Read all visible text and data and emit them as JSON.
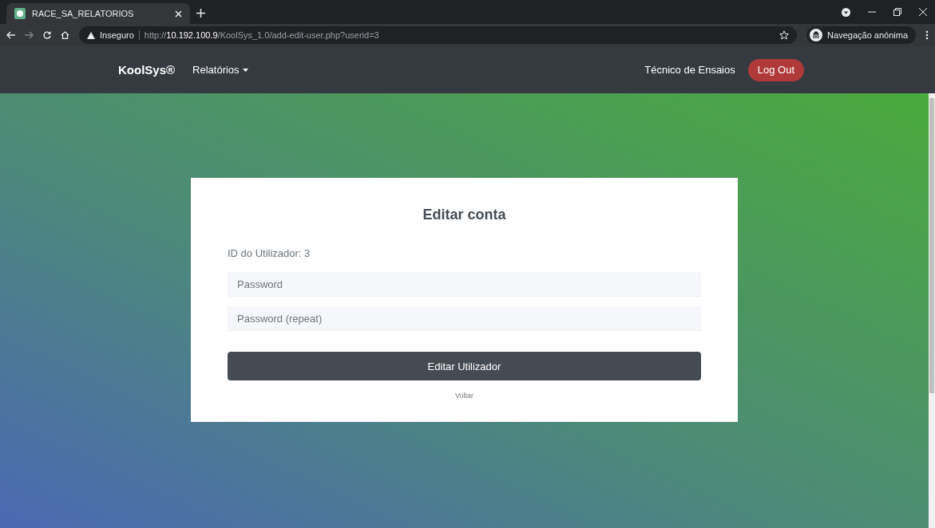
{
  "browser": {
    "tab_title": "RACE_SA_RELATORIOS",
    "security_label": "Inseguro",
    "url": "http://**10.192.100.9**/KoolSys_1.0/add-edit-user.php?userid=3",
    "profile_label": "Navegação anónima"
  },
  "navbar": {
    "brand": "KoolSys®",
    "menu": "Relatórios",
    "user": "Técnico de Ensaios",
    "logout": "Log Out"
  },
  "card": {
    "title": "Editar conta",
    "user_id": "ID do Utilizador: 3",
    "fields": [
      {
        "placeholder": "Password"
      },
      {
        "placeholder": "Password (repeat)"
      }
    ],
    "submit": "Editar Utilizador",
    "back_link": "Voltar"
  }
}
